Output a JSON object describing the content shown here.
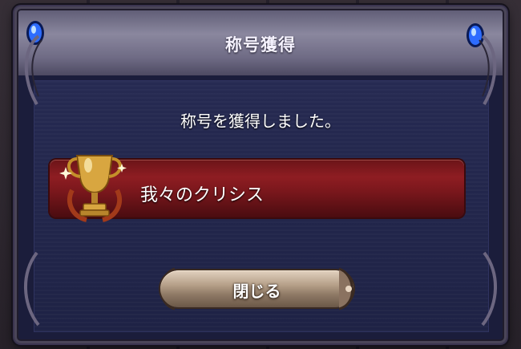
{
  "dialog": {
    "title": "称号獲得",
    "message": "称号を獲得しました。",
    "earned_title": "我々のクリシス",
    "close_label": "閉じる"
  },
  "icons": {
    "trophy": "gold-trophy-icon",
    "orb": "blue-crystal-orb-icon"
  },
  "colors": {
    "title_bar": "#8a879e",
    "body": "#1e2245",
    "banner": "#8e1d22",
    "button": "#b59f88",
    "trophy_gold": "#d8a640"
  }
}
